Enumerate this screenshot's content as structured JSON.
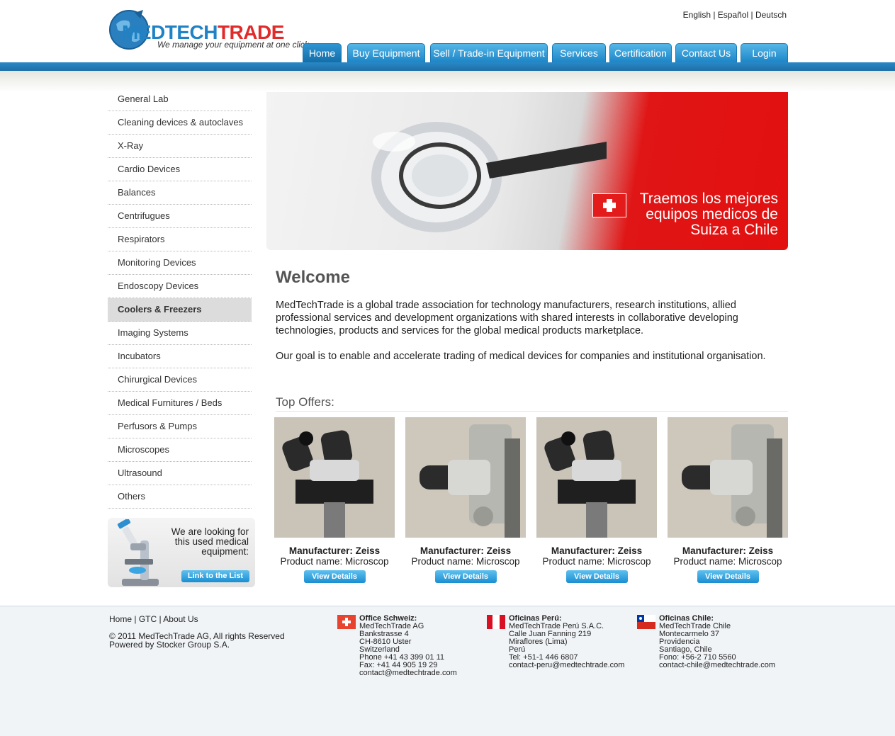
{
  "brand": {
    "logo_part1": "MEDTECH",
    "logo_part2": "TRADE",
    "tagline": "We manage your equipment at one click"
  },
  "languages": [
    "English",
    "Español",
    "Deutsch"
  ],
  "nav": {
    "tabs": [
      "Home",
      "Buy Equipment",
      "Sell / Trade-in Equipment",
      "Services",
      "Certification",
      "Contact Us",
      "Login"
    ],
    "active": "Home"
  },
  "sidebar": {
    "items": [
      "General Lab",
      "Cleaning devices & autoclaves",
      "X-Ray",
      "Cardio Devices",
      "Balances",
      "Centrifugues",
      "Respirators",
      "Monitoring Devices",
      "Endoscopy Devices",
      "Coolers & Freezers",
      "Imaging Systems",
      "Incubators",
      "Chirurgical Devices",
      "Medical Furnitures / Beds",
      "Perfusors & Pumps",
      "Microscopes",
      "Ultrasound",
      "Others"
    ],
    "selected": "Coolers & Freezers"
  },
  "promo": {
    "text": "We are looking for this used medical equipment:",
    "button": "Link to the List"
  },
  "banner": {
    "line1": "Traemos los mejores",
    "line2": "equipos medicos de",
    "line3": "Suiza a Chile"
  },
  "welcome": {
    "title": "Welcome",
    "p1": "MedTechTrade is a global trade association for technology manufacturers, research institutions, allied professional services and development organizations with shared interests in collaborative developing technologies, products and services for the global medical products marketplace.",
    "p2": "Our goal is to enable and accelerate trading of medical devices for companies and institutional organisation."
  },
  "offers": {
    "title": "Top Offers:",
    "items": [
      {
        "manufacturer": "Manufacturer: Zeiss",
        "product": "Product name: Microscop",
        "button": "View Details"
      },
      {
        "manufacturer": "Manufacturer: Zeiss",
        "product": "Product name: Microscop",
        "button": "View Details"
      },
      {
        "manufacturer": "Manufacturer: Zeiss",
        "product": "Product name: Microscop",
        "button": "View Details"
      },
      {
        "manufacturer": "Manufacturer: Zeiss",
        "product": "Product name: Microscop",
        "button": "View Details"
      }
    ]
  },
  "footer": {
    "links": [
      "Home",
      "GTC",
      "About Us"
    ],
    "copyright": "© 2011 MedTechTrade AG, All rights Reserved",
    "powered": "Powered by Stocker Group S.A.",
    "offices": [
      {
        "name": "Office Schweiz:",
        "lines": [
          "MedTechTrade AG",
          "Bankstrasse 4",
          "CH-8610 Uster",
          "Switzerland",
          "Phone +41 43 399 01 11",
          "Fax: +41 44 905 19 29",
          "contact@medtechtrade.com"
        ]
      },
      {
        "name": "Oficinas Perú:",
        "lines": [
          "MedTechTrade Perú S.A.C.",
          "Calle Juan Fanning 219",
          "Miraflores (Lima)",
          "Perú",
          "Tel: +51-1 446 6807",
          "contact-peru@medtechtrade.com"
        ]
      },
      {
        "name": "Oficinas Chile:",
        "lines": [
          "MedTechTrade Chile",
          "Montecarmelo 37",
          "Providencia",
          "Santiago, Chile",
          "Fono: +56-2 710 5560",
          "contact-chile@medtechtrade.com"
        ]
      }
    ]
  }
}
